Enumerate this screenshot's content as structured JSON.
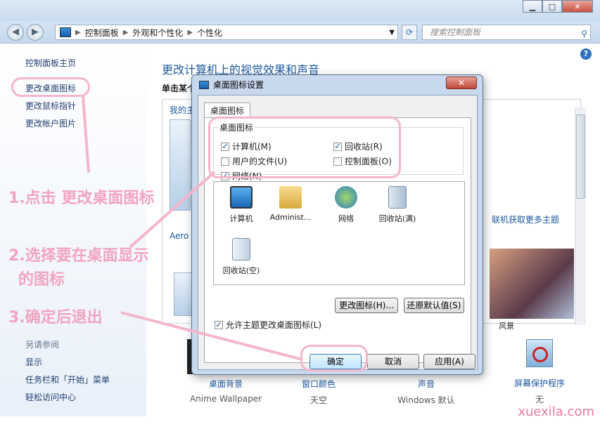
{
  "window": {
    "min": "▁",
    "max": "□",
    "close": "✕"
  },
  "nav": {
    "back": "◀",
    "forward": "▶",
    "breadcrumbs": [
      "控制面板",
      "外观和个性化",
      "个性化"
    ],
    "search_placeholder": "搜索控制面板"
  },
  "sidebar": {
    "home": "控制面板主页",
    "items": [
      "更改桌面图标",
      "更改鼠标指针",
      "更改帐户图片"
    ],
    "see_also_header": "另请参阅",
    "see_also": [
      "显示",
      "任务栏和「开始」菜单",
      "轻松访问中心"
    ]
  },
  "main": {
    "title": "更改计算机上的视觉效果和声音",
    "subtitle": "单击某个",
    "my_themes": "我的主",
    "aero": "Aero 主",
    "more_themes": "联机获取更多主题",
    "bottom": [
      {
        "label": "桌面背景",
        "value": "Anime Wallpaper"
      },
      {
        "label": "窗口颜色",
        "value": "天空"
      },
      {
        "label": "声音",
        "value": "Windows 默认"
      },
      {
        "label": "屏幕保护程序",
        "value": "无"
      }
    ],
    "partial_label": "风景"
  },
  "dialog": {
    "title": "桌面图标设置",
    "tab": "桌面图标",
    "group_label": "桌面图标",
    "checkboxes": [
      {
        "label": "计算机(M)",
        "checked": true
      },
      {
        "label": "回收站(R)",
        "checked": true
      },
      {
        "label": "用户的文件(U)",
        "checked": false
      },
      {
        "label": "控制面板(O)",
        "checked": false
      },
      {
        "label": "网络(N)",
        "checked": true
      }
    ],
    "icons": [
      "计算机",
      "Administ...",
      "网络",
      "回收站(满)",
      "回收站(空)"
    ],
    "change_icon": "更改图标(H)...",
    "restore_default": "还原默认值(S)",
    "allow_themes": "允许主题更改桌面图标(L)",
    "ok": "确定",
    "cancel": "取消",
    "apply": "应用(A)"
  },
  "annotations": {
    "step1": "1.点击 更改桌面图标",
    "step2_line1": "2.选择要在桌面显示",
    "step2_line2": "的图标",
    "step3": "3.确定后退出"
  },
  "watermark": "xuexila.com",
  "colors": {
    "annotation": "#f2a3c2",
    "link": "#1e3d6e",
    "title": "#1e5aa0"
  }
}
